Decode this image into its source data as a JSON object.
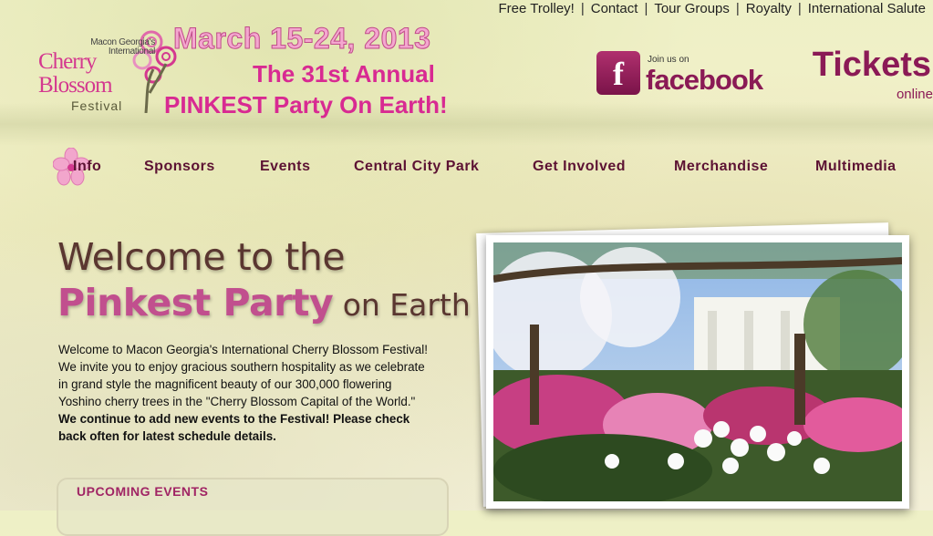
{
  "top_links": [
    "Free Trolley!",
    "Contact",
    "Tour Groups",
    "Royalty",
    "International Salute"
  ],
  "logo": {
    "macon": "Macon Georgia's",
    "international": "International",
    "cherry": "Cherry",
    "blossom": "Blossom",
    "festival": "Festival"
  },
  "header": {
    "dates": "March 15-24, 2013",
    "annual": "The 31st Annual",
    "pinkest": "PINKEST Party On Earth!"
  },
  "facebook": {
    "join": "Join us on",
    "name": "facebook",
    "icon": "f"
  },
  "tickets": {
    "title": "Tickets",
    "sub": "online"
  },
  "nav": [
    "Info",
    "Sponsors",
    "Events",
    "Central City Park",
    "Get Involved",
    "Merchandise",
    "Multimedia"
  ],
  "welcome": {
    "line1": "Welcome to the",
    "pinkest": "Pinkest Party",
    "on_earth": " on Earth",
    "intro": "Welcome to Macon Georgia's International Cherry Blossom Festival! We invite you to enjoy gracious southern hospitality as we celebrate in grand style the magnificent beauty of our 300,000 flowering Yoshino cherry trees in the \"Cherry Blossom Capital of the World.\" ",
    "intro_bold": "We continue to add new events to the Festival! Please check back often for latest schedule details."
  },
  "upcoming": {
    "heading": "UPCOMING EVENTS"
  },
  "colors": {
    "brand_pink": "#d82a92",
    "brand_plum": "#8b1a56",
    "nav_text": "#5c1233"
  }
}
